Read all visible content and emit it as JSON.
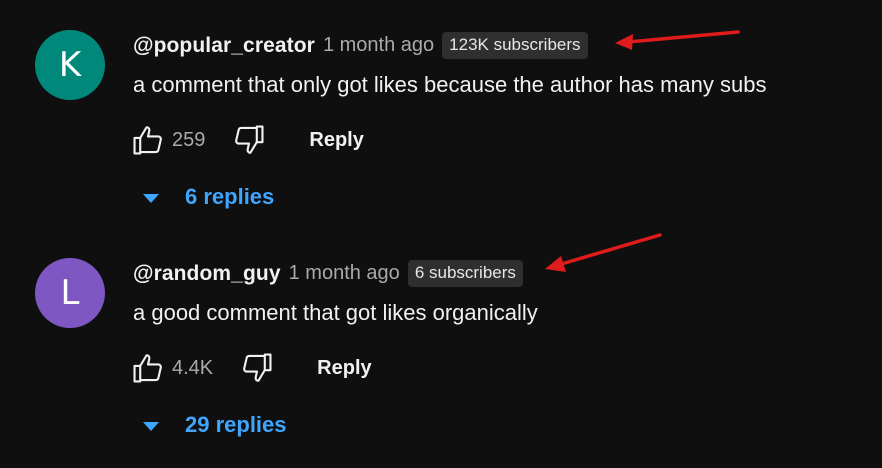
{
  "comments": [
    {
      "avatar_letter": "K",
      "avatar_color": "#00897b",
      "handle": "@popular_creator",
      "time": "1 month ago",
      "subscribers": "123K subscribers",
      "text": "a comment that only got likes because the author has many subs",
      "likes": "259",
      "reply_label": "Reply",
      "replies_label": "6 replies"
    },
    {
      "avatar_letter": "L",
      "avatar_color": "#7e57c2",
      "handle": "@random_guy",
      "time": "1 month ago",
      "subscribers": "6 subscribers",
      "text": "a good comment that got likes organically",
      "likes": "4.4K",
      "reply_label": "Reply",
      "replies_label": "29 replies"
    }
  ],
  "annotations": {
    "arrow_color": "#e01b1b",
    "arrow_targets": [
      "subscriber-badge-1",
      "subscriber-badge-2"
    ]
  },
  "icons": {
    "like": "thumbs-up-icon",
    "dislike": "thumbs-down-icon",
    "expand": "caret-down-icon"
  }
}
